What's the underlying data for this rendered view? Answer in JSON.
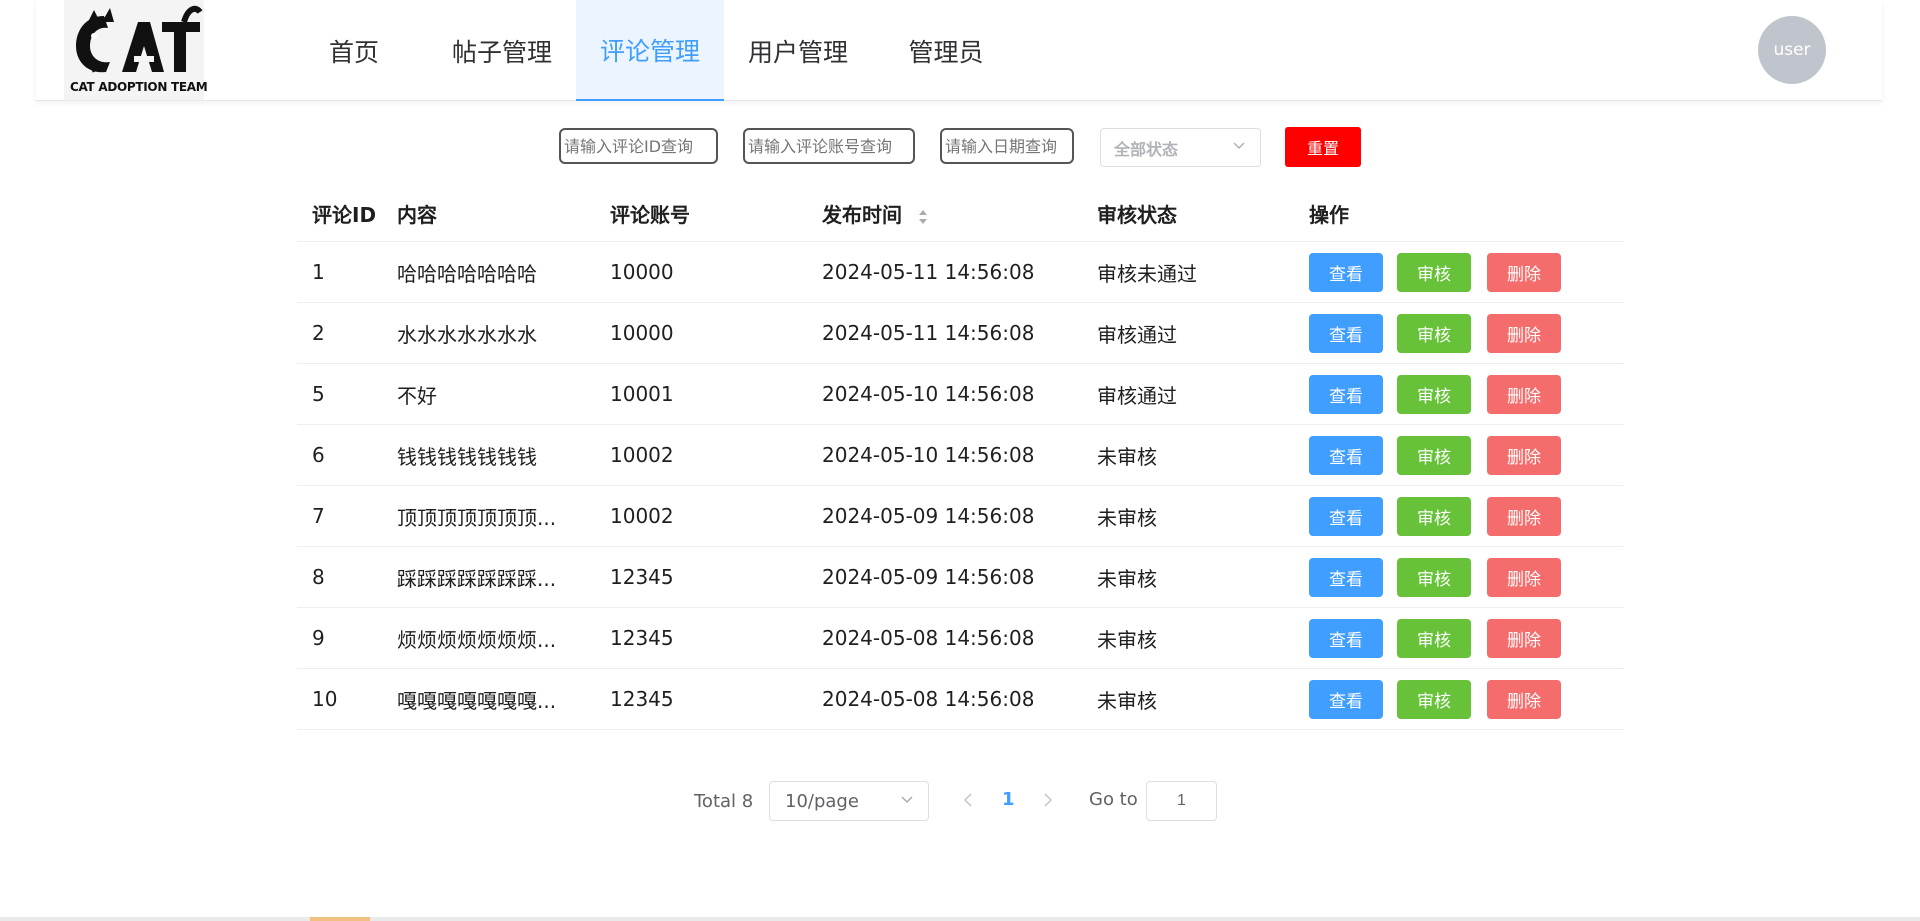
{
  "brand": {
    "logo_text": "CAT ADOPTION TEAM"
  },
  "nav": {
    "items": [
      "首页",
      "帖子管理",
      "评论管理",
      "用户管理",
      "管理员"
    ],
    "active_index": 2
  },
  "user": {
    "avatar_label": "user"
  },
  "filters": {
    "comment_id_placeholder": "请输入评论ID查询",
    "account_placeholder": "请输入评论账号查询",
    "date_placeholder": "请输入日期查询",
    "status_select": "全部状态",
    "reset_label": "重置"
  },
  "table": {
    "headers": [
      "评论ID",
      "内容",
      "评论账号",
      "发布时间",
      "审核状态",
      "操作"
    ],
    "action_labels": {
      "view": "查看",
      "audit": "审核",
      "delete": "删除"
    },
    "rows": [
      {
        "id": "1",
        "content": "哈哈哈哈哈哈哈",
        "account": "10000",
        "time": "2024-05-11 14:56:08",
        "status": "审核未通过"
      },
      {
        "id": "2",
        "content": "水水水水水水水",
        "account": "10000",
        "time": "2024-05-11 14:56:08",
        "status": "审核通过"
      },
      {
        "id": "5",
        "content": "不好",
        "account": "10001",
        "time": "2024-05-10 14:56:08",
        "status": "审核通过"
      },
      {
        "id": "6",
        "content": "钱钱钱钱钱钱钱",
        "account": "10002",
        "time": "2024-05-10 14:56:08",
        "status": "未审核"
      },
      {
        "id": "7",
        "content": "顶顶顶顶顶顶顶...",
        "account": "10002",
        "time": "2024-05-09 14:56:08",
        "status": "未审核"
      },
      {
        "id": "8",
        "content": "踩踩踩踩踩踩踩...",
        "account": "12345",
        "time": "2024-05-09 14:56:08",
        "status": "未审核"
      },
      {
        "id": "9",
        "content": "烦烦烦烦烦烦烦...",
        "account": "12345",
        "time": "2024-05-08 14:56:08",
        "status": "未审核"
      },
      {
        "id": "10",
        "content": "嘎嘎嘎嘎嘎嘎嘎...",
        "account": "12345",
        "time": "2024-05-08 14:56:08",
        "status": "未审核"
      }
    ]
  },
  "pagination": {
    "total_label": "Total 8",
    "page_size": "10/page",
    "current_page": "1",
    "goto_label": "Go to",
    "goto_value": "1"
  },
  "colors": {
    "accent": "#409eff",
    "view_button": "#409eff",
    "audit_button": "#67c23a",
    "delete_button": "#f56c6c",
    "reset_button": "#ff0000"
  }
}
